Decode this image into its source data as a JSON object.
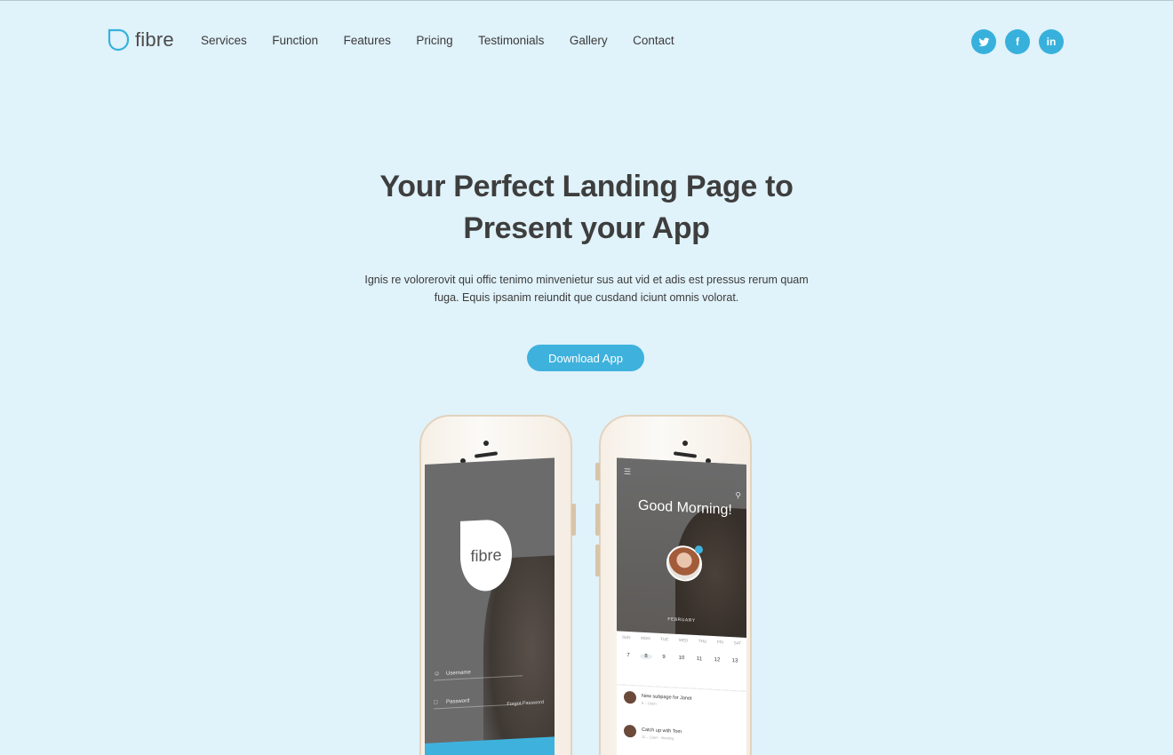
{
  "brand": {
    "name": "fibre",
    "accent": "#37b1dc",
    "background": "#e0f2fa"
  },
  "nav": {
    "items": [
      "Services",
      "Function",
      "Features",
      "Pricing",
      "Testimonials",
      "Gallery",
      "Contact"
    ]
  },
  "socials": [
    {
      "name": "twitter",
      "icon": "twitter-icon"
    },
    {
      "name": "facebook",
      "icon": "facebook-icon",
      "glyph": "f"
    },
    {
      "name": "linkedin",
      "icon": "linkedin-icon",
      "glyph": "in"
    }
  ],
  "hero": {
    "title_line1": "Your Perfect Landing Page to",
    "title_line2": "Present your App",
    "text_line1": "Ignis re volorerovit qui offic tenimo minvenietur sus aut vid et adis est pressus rerum quam",
    "text_line2": "fuga. Equis ipsanim reiundit que cusdand iciunt omnis volorat.",
    "cta": "Download App"
  },
  "phone_left": {
    "logo": "fibre",
    "username_label": "Username",
    "password_label": "Password",
    "forgot_label": "Forgot Password"
  },
  "phone_right": {
    "greeting": "Good Morning!",
    "month": "FEBRUARY",
    "days": [
      "SUN",
      "MON",
      "TUE",
      "WED",
      "THU",
      "FRI",
      "SAT"
    ],
    "dates": [
      "7",
      "8",
      "9",
      "10",
      "11",
      "12",
      "13"
    ],
    "events": [
      {
        "title": "New subpage for Janet",
        "time": "8 – 10am"
      },
      {
        "title": "Catch up with Tom",
        "time": "11 – 12am · Meeting"
      }
    ]
  }
}
